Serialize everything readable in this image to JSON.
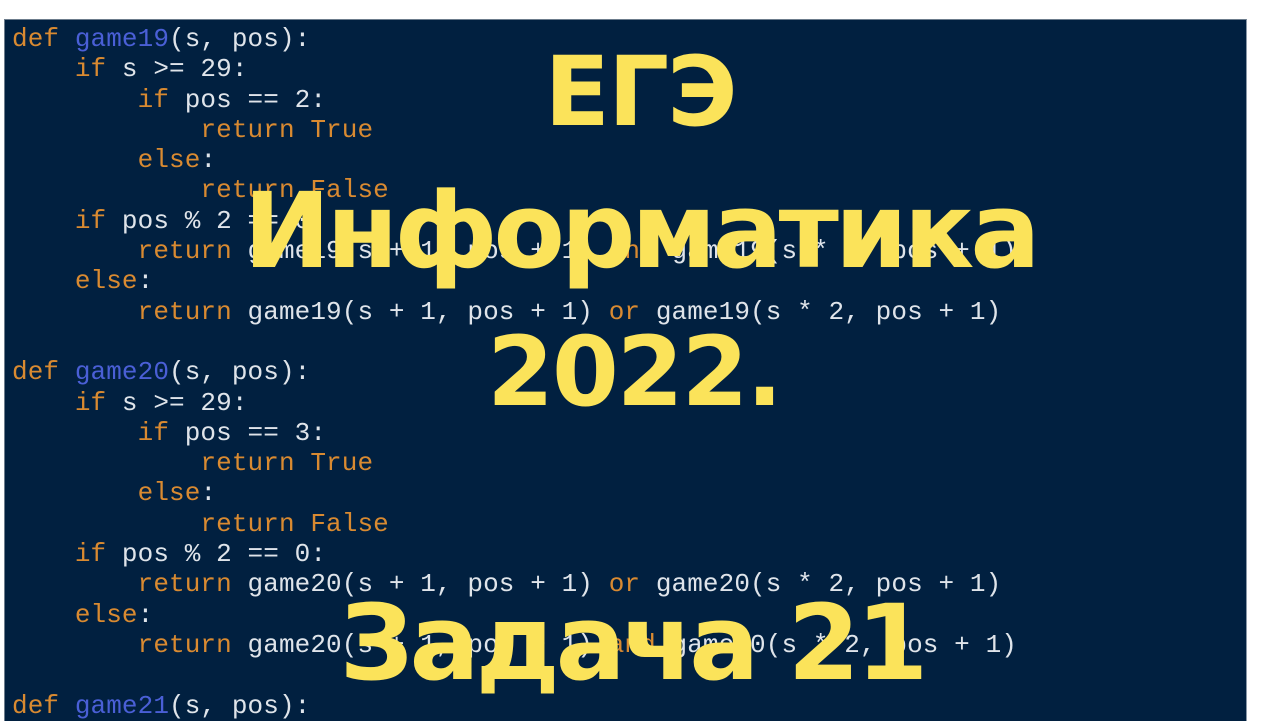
{
  "colors": {
    "background": "#012040",
    "keyword": "#d98a31",
    "function_name": "#4a5fd6",
    "text": "#dfe4ea",
    "title": "#fbe35a"
  },
  "titles": {
    "line1": "ЕГЭ",
    "line2": "Информатика",
    "line3": "2022.",
    "line4": "Задача 21"
  },
  "code_lines": [
    [
      {
        "t": "def",
        "c": "kw"
      },
      {
        "t": " ",
        "c": "tx"
      },
      {
        "t": "game19",
        "c": "fn"
      },
      {
        "t": "(s, pos):",
        "c": "tx"
      }
    ],
    [
      {
        "t": "    ",
        "c": "tx"
      },
      {
        "t": "if",
        "c": "kw"
      },
      {
        "t": " s >= 29:",
        "c": "tx"
      }
    ],
    [
      {
        "t": "        ",
        "c": "tx"
      },
      {
        "t": "if",
        "c": "kw"
      },
      {
        "t": " pos == 2:",
        "c": "tx"
      }
    ],
    [
      {
        "t": "            ",
        "c": "tx"
      },
      {
        "t": "return True",
        "c": "kw"
      }
    ],
    [
      {
        "t": "        ",
        "c": "tx"
      },
      {
        "t": "else",
        "c": "kw"
      },
      {
        "t": ":",
        "c": "tx"
      }
    ],
    [
      {
        "t": "            ",
        "c": "tx"
      },
      {
        "t": "return False",
        "c": "kw"
      }
    ],
    [
      {
        "t": "    ",
        "c": "tx"
      },
      {
        "t": "if",
        "c": "kw"
      },
      {
        "t": " pos % 2 == 0:",
        "c": "tx"
      }
    ],
    [
      {
        "t": "        ",
        "c": "tx"
      },
      {
        "t": "return",
        "c": "kw"
      },
      {
        "t": " game19(s + 1, pos + 1) ",
        "c": "tx"
      },
      {
        "t": "and",
        "c": "kw"
      },
      {
        "t": " game19(s * 2, pos + 1)",
        "c": "tx"
      }
    ],
    [
      {
        "t": "    ",
        "c": "tx"
      },
      {
        "t": "else",
        "c": "kw"
      },
      {
        "t": ":",
        "c": "tx"
      }
    ],
    [
      {
        "t": "        ",
        "c": "tx"
      },
      {
        "t": "return",
        "c": "kw"
      },
      {
        "t": " game19(s + 1, pos + 1) ",
        "c": "tx"
      },
      {
        "t": "or",
        "c": "kw"
      },
      {
        "t": " game19(s * 2, pos + 1)",
        "c": "tx"
      }
    ],
    [],
    [
      {
        "t": "def",
        "c": "kw"
      },
      {
        "t": " ",
        "c": "tx"
      },
      {
        "t": "game20",
        "c": "fn"
      },
      {
        "t": "(s, pos):",
        "c": "tx"
      }
    ],
    [
      {
        "t": "    ",
        "c": "tx"
      },
      {
        "t": "if",
        "c": "kw"
      },
      {
        "t": " s >= 29:",
        "c": "tx"
      }
    ],
    [
      {
        "t": "        ",
        "c": "tx"
      },
      {
        "t": "if",
        "c": "kw"
      },
      {
        "t": " pos == 3:",
        "c": "tx"
      }
    ],
    [
      {
        "t": "            ",
        "c": "tx"
      },
      {
        "t": "return True",
        "c": "kw"
      }
    ],
    [
      {
        "t": "        ",
        "c": "tx"
      },
      {
        "t": "else",
        "c": "kw"
      },
      {
        "t": ":",
        "c": "tx"
      }
    ],
    [
      {
        "t": "            ",
        "c": "tx"
      },
      {
        "t": "return False",
        "c": "kw"
      }
    ],
    [
      {
        "t": "    ",
        "c": "tx"
      },
      {
        "t": "if",
        "c": "kw"
      },
      {
        "t": " pos % 2 == 0:",
        "c": "tx"
      }
    ],
    [
      {
        "t": "        ",
        "c": "tx"
      },
      {
        "t": "return",
        "c": "kw"
      },
      {
        "t": " game20(s + 1, pos + 1) ",
        "c": "tx"
      },
      {
        "t": "or",
        "c": "kw"
      },
      {
        "t": " game20(s * 2, pos + 1)",
        "c": "tx"
      }
    ],
    [
      {
        "t": "    ",
        "c": "tx"
      },
      {
        "t": "else",
        "c": "kw"
      },
      {
        "t": ":",
        "c": "tx"
      }
    ],
    [
      {
        "t": "        ",
        "c": "tx"
      },
      {
        "t": "return",
        "c": "kw"
      },
      {
        "t": " game20(s + 1, pos + 1) ",
        "c": "tx"
      },
      {
        "t": "and",
        "c": "kw"
      },
      {
        "t": " game20(s * 2, pos + 1)",
        "c": "tx"
      }
    ],
    [],
    [
      {
        "t": "def",
        "c": "kw"
      },
      {
        "t": " ",
        "c": "tx"
      },
      {
        "t": "game21",
        "c": "fn"
      },
      {
        "t": "(s, pos):",
        "c": "tx"
      }
    ]
  ]
}
